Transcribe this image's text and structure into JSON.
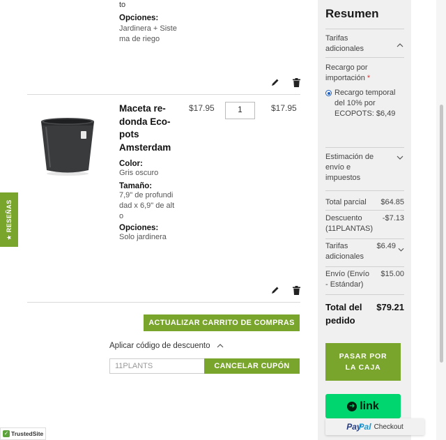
{
  "colors": {
    "accent_green": "#7aa52c",
    "link_green": "#00d66f",
    "paypal_blue": "#253b80",
    "paypal_light": "#179bd7"
  },
  "cart": {
    "item1": {
      "partial_text": "to",
      "options_label": "Opciones:",
      "options_lines": [
        "Jardinera + Siste",
        "ma de riego"
      ]
    },
    "item2": {
      "name_lines": [
        "Maceta re-",
        "donda Eco-",
        "pots",
        "Amsterdam"
      ],
      "price": "$17.95",
      "quantity": "1",
      "subtotal": "$17.95",
      "color_label": "Color:",
      "color_value": "Gris oscuro",
      "size_label": "Tamaño:",
      "size_lines": [
        "7,9\" de profundi",
        "dad x 6,9\" de alt",
        "o"
      ],
      "options_label": "Opciones:",
      "options_value": "Solo jardinera"
    },
    "update_button": "ACTUALIZAR CARRITO DE COMPRAS",
    "discount": {
      "toggle_label": "Aplicar código de descuento",
      "code_value": "11PLANTS",
      "cancel_button": "CANCELAR CUPÓN"
    }
  },
  "reviews_tab": "★ RESEÑAS",
  "trusted_site": "TrustedSite",
  "summary": {
    "title": "Resumen",
    "tarifas_section": {
      "lines": [
        "Tarifas",
        "adicionales"
      ]
    },
    "recargo_label": {
      "lines": [
        "Recargo por",
        "importación"
      ],
      "required_mark": "*"
    },
    "recargo_option": {
      "lines": [
        "Recargo temporal",
        "del 10% por",
        "ECOPOTS: $6,49"
      ]
    },
    "shipping_section": {
      "lines": [
        "Estimación de",
        "envío e",
        "impuestos"
      ]
    },
    "rows": {
      "subtotal": {
        "label": "Total parcial",
        "value": "$64.85"
      },
      "discount": {
        "label_lines": [
          "Descuento",
          "(11PLANTAS)"
        ],
        "value": "-$7.13"
      },
      "fees": {
        "label_lines": [
          "Tarifas",
          "adicionales"
        ],
        "value": "$6.49"
      },
      "shipping": {
        "label_lines": [
          "Envío (Envío",
          "- Estándar)"
        ],
        "value": "$15.00"
      }
    },
    "order_total": {
      "label_lines": [
        "Total del",
        "pedido"
      ],
      "value": "$79.21"
    },
    "checkout_button": {
      "lines": [
        "PASAR POR",
        "LA CAJA"
      ]
    },
    "link_button": "link",
    "paypal": {
      "pay": "Pay",
      "pal": "Pal",
      "checkout": "Checkout"
    }
  }
}
